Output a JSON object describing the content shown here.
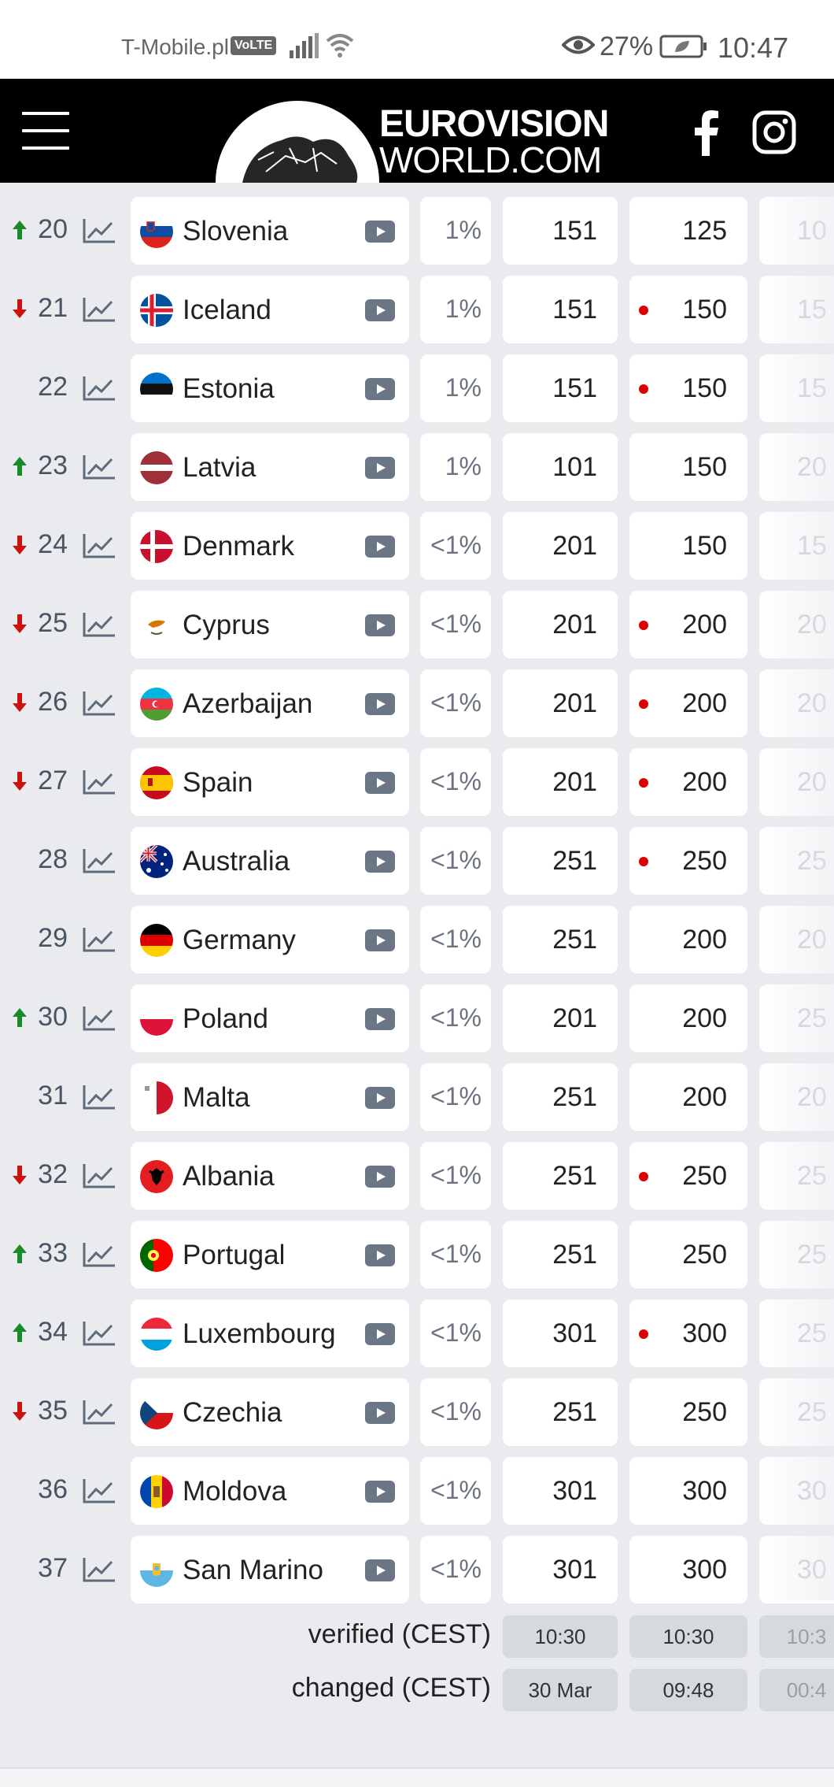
{
  "status_bar": {
    "carrier": "T-Mobile.pl",
    "volte": "VoLTE",
    "battery": "27%",
    "time": "10:47"
  },
  "header": {
    "logo_line1": "EUROVISION",
    "logo_line2": "WORLD.COM"
  },
  "rows": [
    {
      "rank": "20",
      "move": "up",
      "country": "Slovenia",
      "flag": "slovenia",
      "pct": "1%",
      "odd1": "151",
      "odd2": "125",
      "dot": false,
      "odd3": "10"
    },
    {
      "rank": "21",
      "move": "down",
      "country": "Iceland",
      "flag": "iceland",
      "pct": "1%",
      "odd1": "151",
      "odd2": "150",
      "dot": true,
      "odd3": "15"
    },
    {
      "rank": "22",
      "move": "none",
      "country": "Estonia",
      "flag": "estonia",
      "pct": "1%",
      "odd1": "151",
      "odd2": "150",
      "dot": true,
      "odd3": "15"
    },
    {
      "rank": "23",
      "move": "up",
      "country": "Latvia",
      "flag": "latvia",
      "pct": "1%",
      "odd1": "101",
      "odd2": "150",
      "dot": false,
      "odd3": "20"
    },
    {
      "rank": "24",
      "move": "down",
      "country": "Denmark",
      "flag": "denmark",
      "pct": "<1%",
      "odd1": "201",
      "odd2": "150",
      "dot": false,
      "odd3": "15"
    },
    {
      "rank": "25",
      "move": "down",
      "country": "Cyprus",
      "flag": "cyprus",
      "pct": "<1%",
      "odd1": "201",
      "odd2": "200",
      "dot": true,
      "odd3": "20"
    },
    {
      "rank": "26",
      "move": "down",
      "country": "Azerbaijan",
      "flag": "azerbaijan",
      "pct": "<1%",
      "odd1": "201",
      "odd2": "200",
      "dot": true,
      "odd3": "20"
    },
    {
      "rank": "27",
      "move": "down",
      "country": "Spain",
      "flag": "spain",
      "pct": "<1%",
      "odd1": "201",
      "odd2": "200",
      "dot": true,
      "odd3": "20"
    },
    {
      "rank": "28",
      "move": "none",
      "country": "Australia",
      "flag": "australia",
      "pct": "<1%",
      "odd1": "251",
      "odd2": "250",
      "dot": true,
      "odd3": "25"
    },
    {
      "rank": "29",
      "move": "none",
      "country": "Germany",
      "flag": "germany",
      "pct": "<1%",
      "odd1": "251",
      "odd2": "200",
      "dot": false,
      "odd3": "20"
    },
    {
      "rank": "30",
      "move": "up",
      "country": "Poland",
      "flag": "poland",
      "pct": "<1%",
      "odd1": "201",
      "odd2": "200",
      "dot": false,
      "odd3": "25"
    },
    {
      "rank": "31",
      "move": "none",
      "country": "Malta",
      "flag": "malta",
      "pct": "<1%",
      "odd1": "251",
      "odd2": "200",
      "dot": false,
      "odd3": "20"
    },
    {
      "rank": "32",
      "move": "down",
      "country": "Albania",
      "flag": "albania",
      "pct": "<1%",
      "odd1": "251",
      "odd2": "250",
      "dot": true,
      "odd3": "25"
    },
    {
      "rank": "33",
      "move": "up",
      "country": "Portugal",
      "flag": "portugal",
      "pct": "<1%",
      "odd1": "251",
      "odd2": "250",
      "dot": false,
      "odd3": "25"
    },
    {
      "rank": "34",
      "move": "up",
      "country": "Luxembourg",
      "flag": "luxembourg",
      "pct": "<1%",
      "odd1": "301",
      "odd2": "300",
      "dot": true,
      "odd3": "25"
    },
    {
      "rank": "35",
      "move": "down",
      "country": "Czechia",
      "flag": "czechia",
      "pct": "<1%",
      "odd1": "251",
      "odd2": "250",
      "dot": false,
      "odd3": "25"
    },
    {
      "rank": "36",
      "move": "none",
      "country": "Moldova",
      "flag": "moldova",
      "pct": "<1%",
      "odd1": "301",
      "odd2": "300",
      "dot": false,
      "odd3": "30"
    },
    {
      "rank": "37",
      "move": "none",
      "country": "San Marino",
      "flag": "sanmarino",
      "pct": "<1%",
      "odd1": "301",
      "odd2": "300",
      "dot": false,
      "odd3": "30"
    }
  ],
  "footer": {
    "verified_label": "verified (CEST)",
    "changed_label": "changed (CEST)",
    "verified": [
      "10:30",
      "10:30",
      "10:3"
    ],
    "changed": [
      "30 Mar",
      "09:48",
      "00:4"
    ]
  },
  "colors": {
    "up": "#1a8a2a",
    "down": "#cc1111",
    "dot": "#dd0000"
  }
}
